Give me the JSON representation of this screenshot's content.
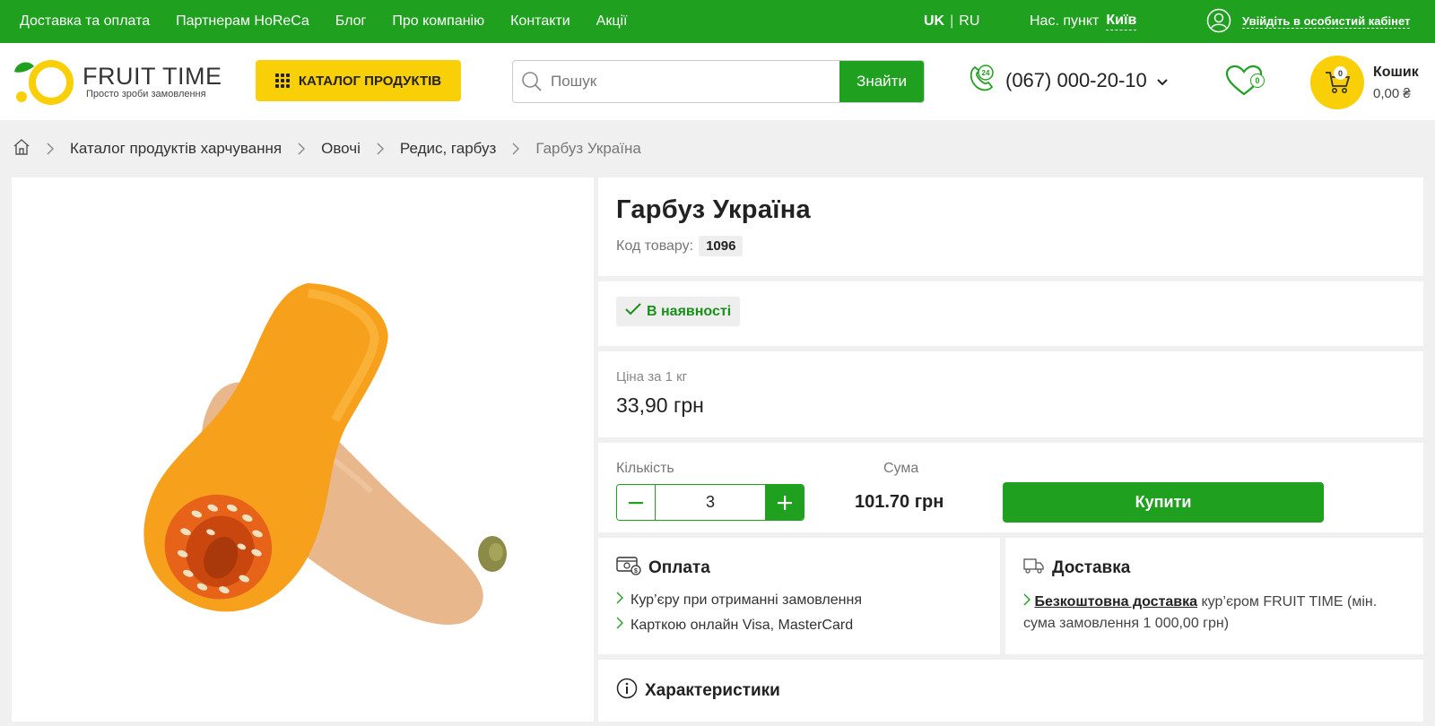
{
  "topbar": {
    "nav": [
      "Доставка та оплата",
      "Партнерам HoReCa",
      "Блог",
      "Про компанію",
      "Контакти",
      "Акції"
    ],
    "lang_active": "UK",
    "lang_sep": "|",
    "lang_other": "RU",
    "city_label": "Нас. пункт",
    "city_value": "Київ",
    "cabinet": "Увійдіть в особистий кабінет"
  },
  "header": {
    "logo_title": "FRUIT TIME",
    "logo_sub": "Просто зроби замовлення",
    "catalog_label": "КАТАЛОГ ПРОДУКТІВ",
    "search_placeholder": "Пошук",
    "search_button": "Знайти",
    "phone_badge": "24",
    "phone": "(067) 000-20-10",
    "wishlist_count": "0",
    "cart_count": "0",
    "cart_label": "Кошик",
    "cart_sum": "0,00 ₴"
  },
  "breadcrumb": {
    "items": [
      "Каталог продуктів харчування",
      "Овочі",
      "Редис, гарбуз"
    ],
    "current": "Гарбуз Україна"
  },
  "product": {
    "title": "Гарбуз Україна",
    "code_label": "Код товару:",
    "code": "1096",
    "stock": "В наявності",
    "price_label": "Ціна за 1 кг",
    "price": "33,90 грн",
    "qty_label": "Кількість",
    "qty": "3",
    "sum_label": "Сума",
    "sum": "101.70 грн",
    "buy": "Купити"
  },
  "payment": {
    "title": "Оплата",
    "items": [
      "Кур’єру при отриманні замовлення",
      "Карткою онлайн Visa, MasterCard"
    ]
  },
  "delivery": {
    "title": "Доставка",
    "link": "Безкоштовна доставка",
    "text": " кур’єром FRUIT TIME (мін. сума замовлення 1 000,00 грн)"
  },
  "characteristics": {
    "title": "Характеристики"
  },
  "colors": {
    "green": "#1fa01f",
    "yellow": "#f9cf08"
  }
}
